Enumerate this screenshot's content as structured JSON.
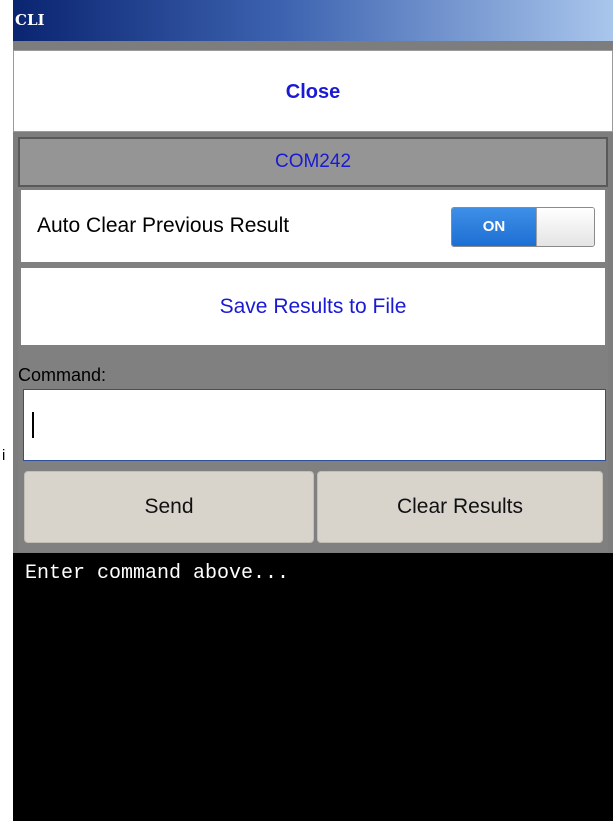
{
  "window": {
    "title": "CLI"
  },
  "close_button": {
    "label": "Close"
  },
  "device": {
    "name": "COM242"
  },
  "auto_clear": {
    "label": "Auto Clear Previous Result",
    "toggle_state": "ON"
  },
  "save_button": {
    "label": "Save Results to File"
  },
  "command": {
    "label": "Command:",
    "value": "",
    "placeholder": ""
  },
  "actions": {
    "send_label": "Send",
    "clear_label": "Clear Results"
  },
  "output": {
    "text": "Enter command above..."
  },
  "stray_text": "i",
  "colors": {
    "title_gradient_start": "#0a2470",
    "title_gradient_end": "#a9c6ec",
    "link_blue": "#1a1ad4",
    "toggle_on": "#1e6fd4",
    "button_face": "#d8d4cc",
    "panel_gray": "#808080",
    "output_bg": "#000000"
  }
}
